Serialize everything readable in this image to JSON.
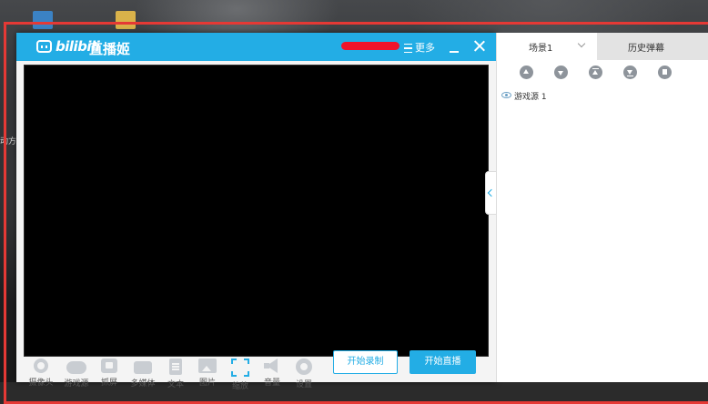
{
  "desktop": {
    "side_text": "动方"
  },
  "app": {
    "logo_bili": "bilibili",
    "logo_live": "直播姬",
    "more_label": "更多"
  },
  "toolbar": {
    "tools": [
      {
        "label": "摄像头",
        "icon": "camera-icon"
      },
      {
        "label": "游戏源",
        "icon": "gamepad-icon"
      },
      {
        "label": "抓屏",
        "icon": "screen-capture-icon"
      },
      {
        "label": "多媒体",
        "icon": "media-icon"
      },
      {
        "label": "文本",
        "icon": "text-icon"
      },
      {
        "label": "图片",
        "icon": "image-icon"
      },
      {
        "label": "缩放",
        "icon": "zoom-icon"
      },
      {
        "label": "音量",
        "icon": "volume-icon"
      },
      {
        "label": "设置",
        "icon": "gear-icon"
      }
    ],
    "record_label": "开始录制",
    "live_label": "开始直播"
  },
  "panel": {
    "scene_tab": "场景1",
    "history_tab": "历史弹幕",
    "sources": [
      {
        "label": "游戏源 1"
      }
    ]
  },
  "colors": {
    "accent": "#23ade5",
    "redact": "#f0142a",
    "frame": "#e53935"
  }
}
